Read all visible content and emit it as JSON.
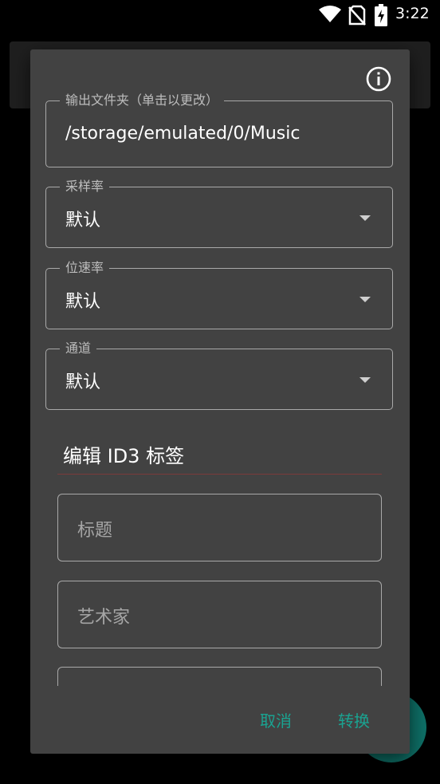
{
  "status_bar": {
    "time": "3:22"
  },
  "dialog": {
    "output_folder": {
      "label": "输出文件夹（单击以更改）",
      "value": "/storage/emulated/0/Music"
    },
    "sample_rate": {
      "label": "采样率",
      "value": "默认"
    },
    "bit_rate": {
      "label": "位速率",
      "value": "默认"
    },
    "channel": {
      "label": "通道",
      "value": "默认"
    },
    "id3": {
      "title": "编辑 ID3 标签",
      "title_placeholder": "标题",
      "artist_placeholder": "艺术家"
    },
    "buttons": {
      "cancel": "取消",
      "convert": "转换"
    }
  },
  "colors": {
    "dialog_bg": "#424242",
    "accent": "#1aa391",
    "fab": "#0e6f66",
    "divider": "#7b3a3a"
  },
  "icons": [
    "wifi-icon",
    "no-sim-icon",
    "battery-charging-icon",
    "info-icon",
    "dropdown-arrow-icon"
  ]
}
